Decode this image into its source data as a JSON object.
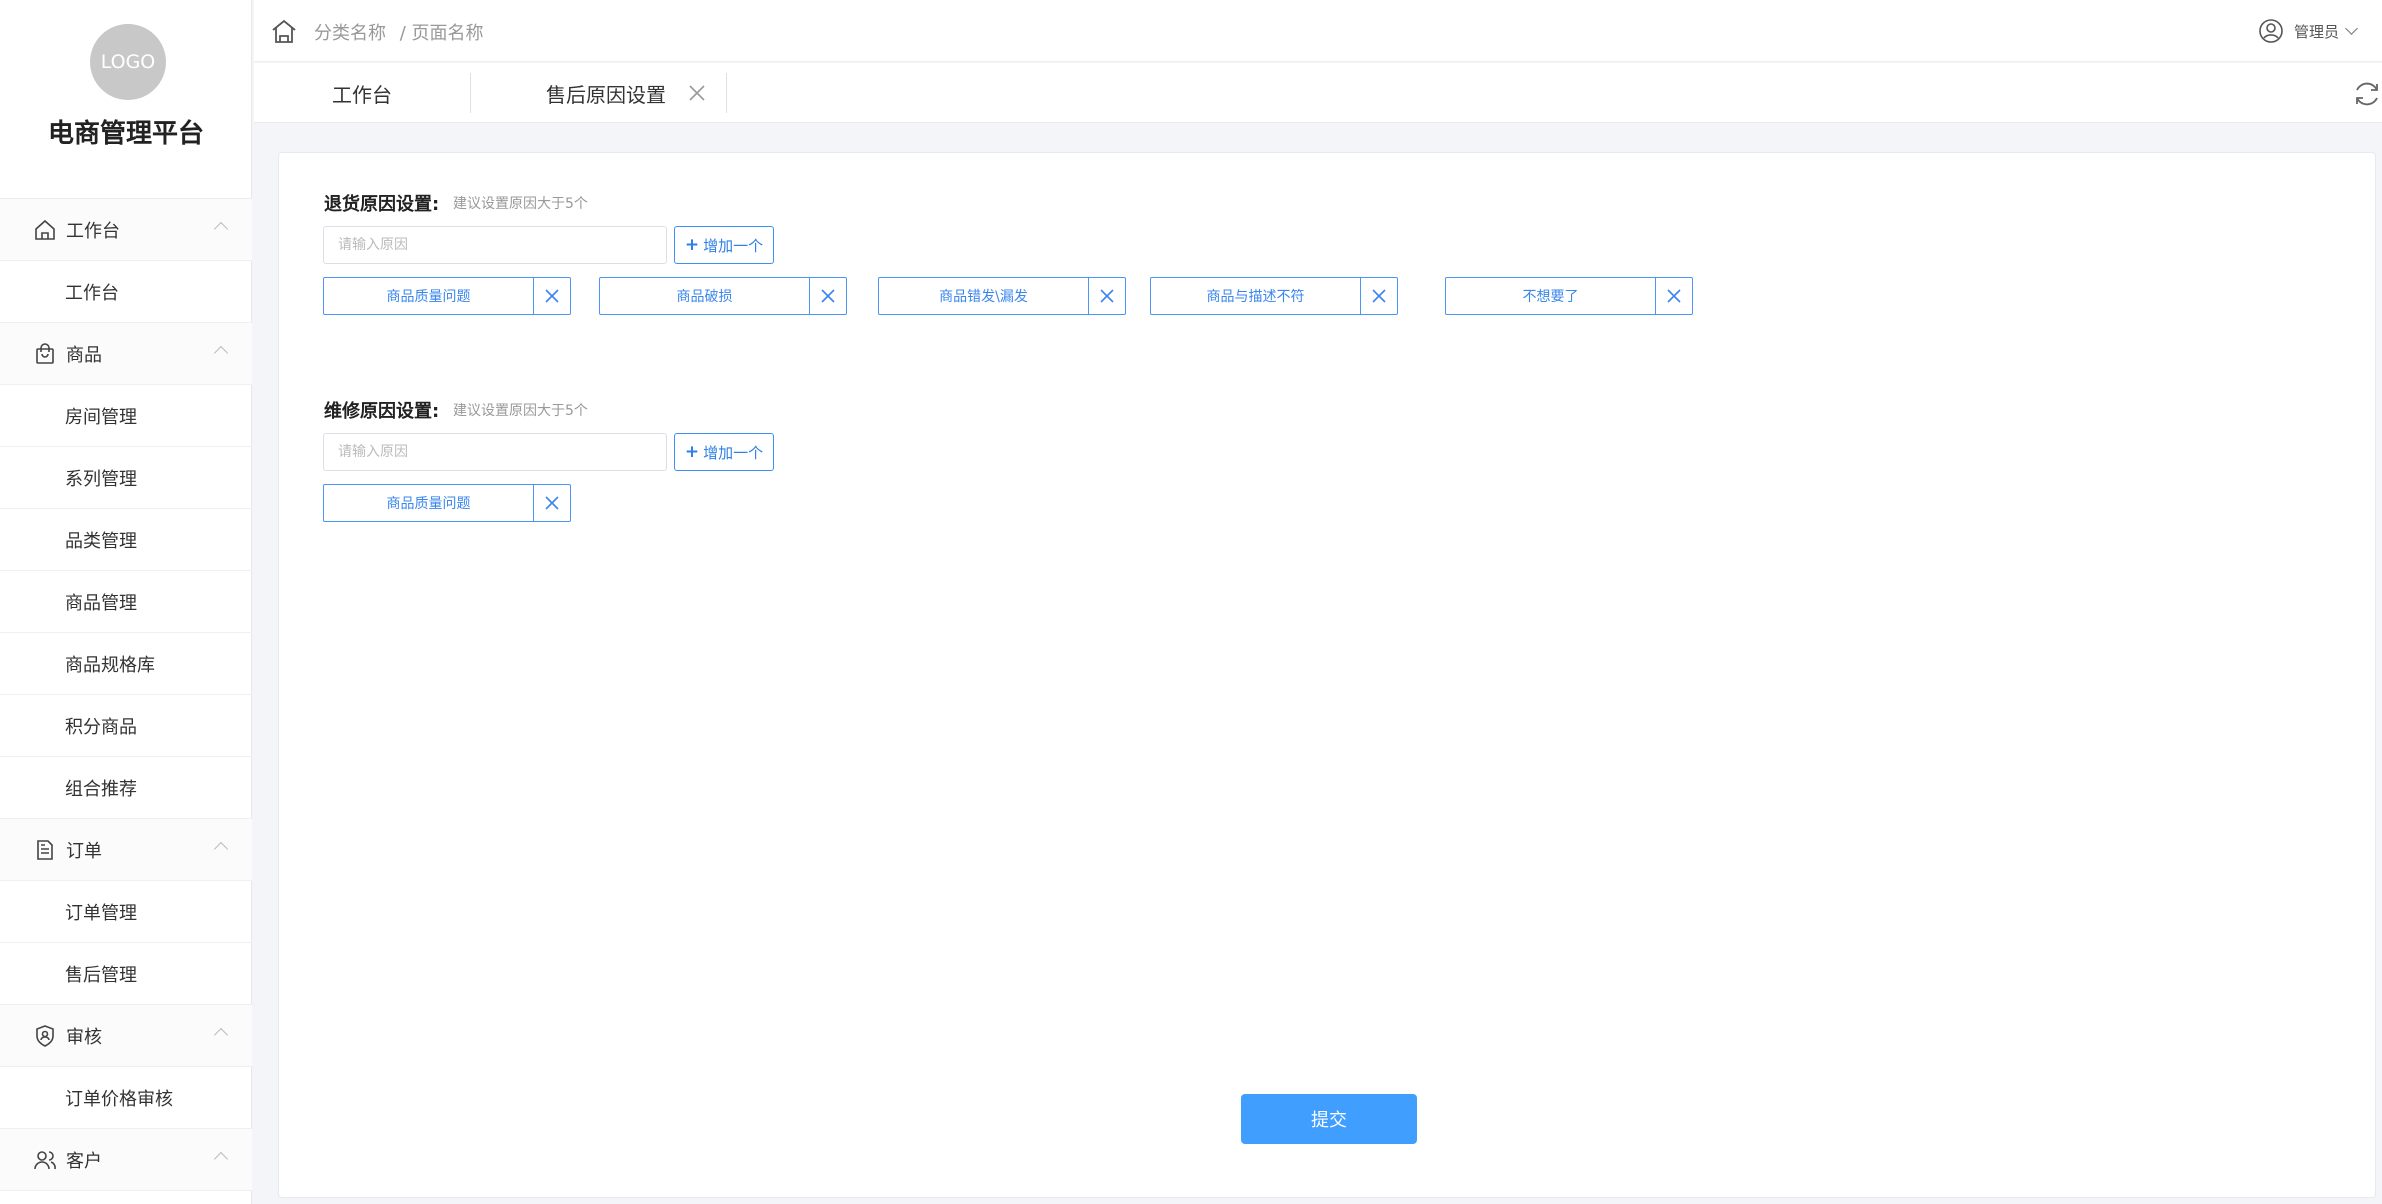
{
  "app": {
    "logo_text": "LOGO",
    "brand": "电商管理平台"
  },
  "sidebar": {
    "groups": [
      {
        "label": "工作台",
        "icon": "home-icon",
        "items": [
          "工作台"
        ]
      },
      {
        "label": "商品",
        "icon": "shopping-bag-icon",
        "items": [
          "房间管理",
          "系列管理",
          "品类管理",
          "商品管理",
          "商品规格库",
          "积分商品",
          "组合推荐"
        ]
      },
      {
        "label": "订单",
        "icon": "document-icon",
        "items": [
          "订单管理",
          "售后管理"
        ]
      },
      {
        "label": "审核",
        "icon": "shield-user-icon",
        "items": [
          "订单价格审核"
        ]
      },
      {
        "label": "客户",
        "icon": "users-icon",
        "items": []
      }
    ]
  },
  "header": {
    "breadcrumb": [
      "分类名称",
      "/ 页面名称"
    ],
    "user": "管理员"
  },
  "tabs": [
    {
      "label": "工作台",
      "closable": false
    },
    {
      "label": "售后原因设置",
      "closable": true
    }
  ],
  "return_section": {
    "title": "退货原因设置:",
    "hint": "建议设置原因大于5个",
    "placeholder": "请输入原因",
    "add_label": "增加一个",
    "tags": [
      "商品质量问题",
      "商品破损",
      "商品错发\\漏发",
      "商品与描述不符",
      "不想要了"
    ]
  },
  "repair_section": {
    "title": "维修原因设置:",
    "hint": "建议设置原因大于5个",
    "placeholder": "请输入原因",
    "add_label": "增加一个",
    "tags": [
      "商品质量问题"
    ]
  },
  "submit_label": "提交",
  "colors": {
    "primary": "#409eff",
    "tag_border": "#4a95f5",
    "tag_text": "#3a86ee"
  }
}
